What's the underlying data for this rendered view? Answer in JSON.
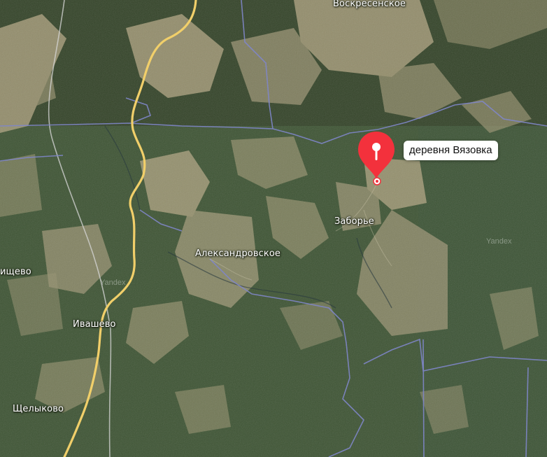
{
  "map": {
    "selected_place": {
      "callout_label": "деревня Вязовка",
      "marker_color": "#f3313c"
    },
    "places": [
      {
        "id": "voskresenskoe",
        "label": "Воскресенское"
      },
      {
        "id": "zaborye",
        "label": "Заборье"
      },
      {
        "id": "aleksandrovskoe",
        "label": "Александровское"
      },
      {
        "id": "ishchevo",
        "label": "ищево"
      },
      {
        "id": "ivashevo",
        "label": "Ивашево"
      },
      {
        "id": "shchelykovo",
        "label": "Щелыково"
      }
    ],
    "watermarks": [
      "Yandex",
      "Yandex"
    ],
    "colors": {
      "forest": "#33482a",
      "field": "#a49a78",
      "road": "#f1cf6a",
      "boundary": "#7f86c8",
      "railway": "#d7d7d7"
    },
    "icons": {
      "marker": "map-pin-icon",
      "location_dot": "location-dot-icon"
    }
  }
}
